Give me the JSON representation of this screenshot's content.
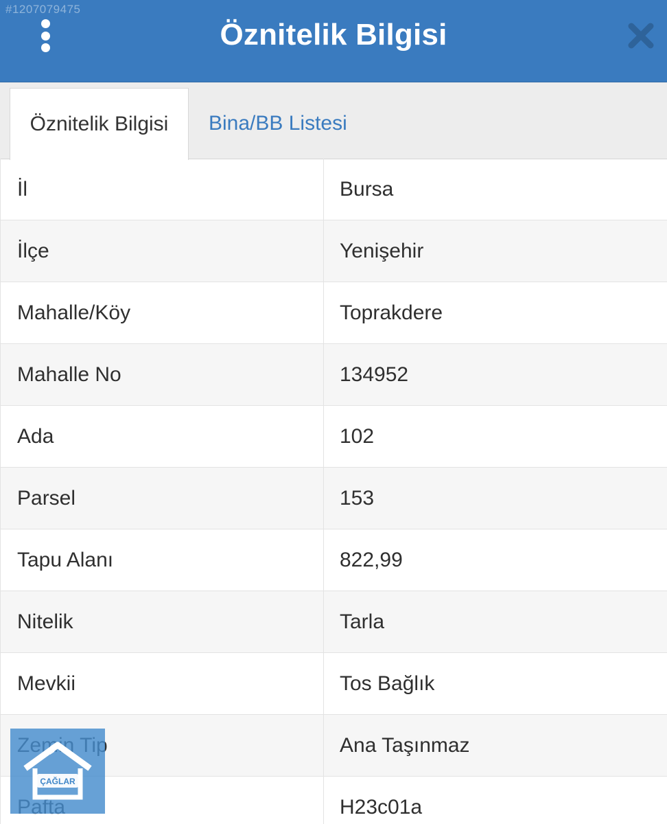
{
  "watermark_id": "#1207079475",
  "header": {
    "title": "Öznitelik Bilgisi",
    "menu_icon": "more-vertical-icon",
    "close_icon": "close-icon",
    "color": "#3a7bbf"
  },
  "tabs": [
    {
      "label": "Öznitelik Bilgisi",
      "active": true
    },
    {
      "label": "Bina/BB Listesi",
      "active": false
    }
  ],
  "rows": [
    {
      "key": "İl",
      "value": "Bursa"
    },
    {
      "key": "İlçe",
      "value": "Yenişehir"
    },
    {
      "key": "Mahalle/Köy",
      "value": "Toprakdere"
    },
    {
      "key": "Mahalle No",
      "value": "134952"
    },
    {
      "key": "Ada",
      "value": "102"
    },
    {
      "key": "Parsel",
      "value": "153"
    },
    {
      "key": "Tapu Alanı",
      "value": "822,99"
    },
    {
      "key": "Nitelik",
      "value": "Tarla"
    },
    {
      "key": "Mevkii",
      "value": "Tos Bağlık"
    },
    {
      "key": "Zemin Tip",
      "value": "Ana Taşınmaz"
    },
    {
      "key": "Pafta",
      "value": "H23c01a"
    }
  ],
  "logo": {
    "text": "ÇAĞLAR",
    "icon": "house-logo-icon"
  }
}
